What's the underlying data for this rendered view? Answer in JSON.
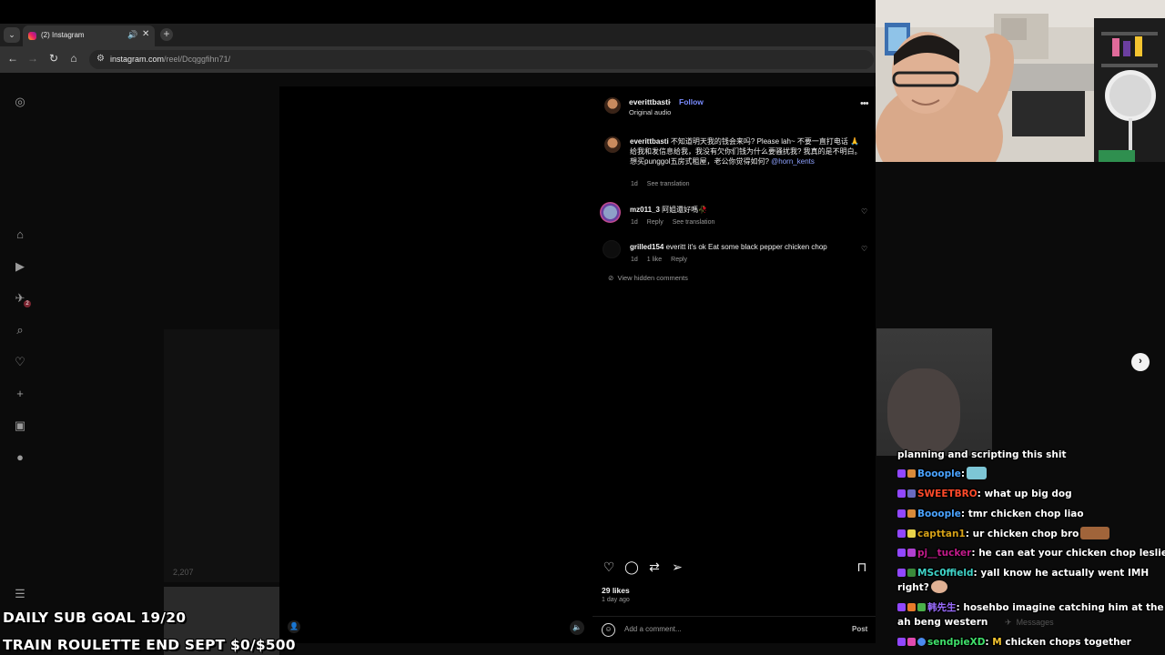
{
  "browser": {
    "tab_title": "(2) Instagram",
    "url_host": "instagram.com",
    "url_path": "/reel/Dcqggfihn71/"
  },
  "post": {
    "author": "everittbasti",
    "separator": "•",
    "follow_label": "Follow",
    "audio": "Original audio",
    "caption_user": "everittbasti",
    "caption_text": " 不知道明天我的钱会来吗? Please lah~ 不要一直打电话 🙏 给我和发信息给我，我没有欠你们钱为什么要骚扰我? 我真的是不明白。想买punggol五房式租屋，老公你觉得如何?",
    "caption_mention": "@horn_kents",
    "caption_time": "1d",
    "caption_translate": "See translation",
    "comments": [
      {
        "user": "mz011_3",
        "text": " 阿姐還好嗎🥀",
        "time": "1d",
        "reply": "Reply",
        "translate": "See translation"
      },
      {
        "user": "grilled154",
        "text": " everitt it's ok Eat some black pepper chicken chop",
        "time": "1d",
        "likes": "1 like",
        "reply": "Reply"
      }
    ],
    "view_hidden": "View hidden comments",
    "likes": "29 likes",
    "date": "1 day ago",
    "comment_placeholder": "Add a comment...",
    "post_label": "Post"
  },
  "background": {
    "views": "2,207",
    "messages": "Messages"
  },
  "chat": [
    {
      "user": "",
      "text": "planning and scripting this shit",
      "color": "#ffffff"
    },
    {
      "user": "Booople",
      "text": ":",
      "color": "#4aa3ff"
    },
    {
      "user": "SWEETBRO",
      "text": ": what up big dog",
      "color": "#ff4a2a"
    },
    {
      "user": "Booople",
      "text": ": tmr chicken chop liao",
      "color": "#4aa3ff"
    },
    {
      "user": "capttan1",
      "text": ": ur chicken chop bro",
      "color": "#d4a017"
    },
    {
      "user": "pj__tucker",
      "text": ": he can eat your chicken chop leslie",
      "color": "#c21b8a"
    },
    {
      "user": "MSc0ffield",
      "text": ": yall know he actually went IMH",
      "color": "#3fd4c8"
    },
    {
      "user": "",
      "text": "right?",
      "color": "#ffffff"
    },
    {
      "user": "韩先生",
      "text": ": hosehbo imagine catching him at the",
      "color": "#9b6cff"
    },
    {
      "user": "",
      "text": "ah beng western",
      "color": "#ffffff"
    },
    {
      "user": "sendpieXD",
      "text": ":",
      "text2": "chicken chops together",
      "color": "#3fe06a"
    }
  ],
  "overlay": {
    "sub_goal": "DAILY SUB GOAL 19/20",
    "roulette": "TRAIN ROULETTE END SEPT $0/$500"
  }
}
